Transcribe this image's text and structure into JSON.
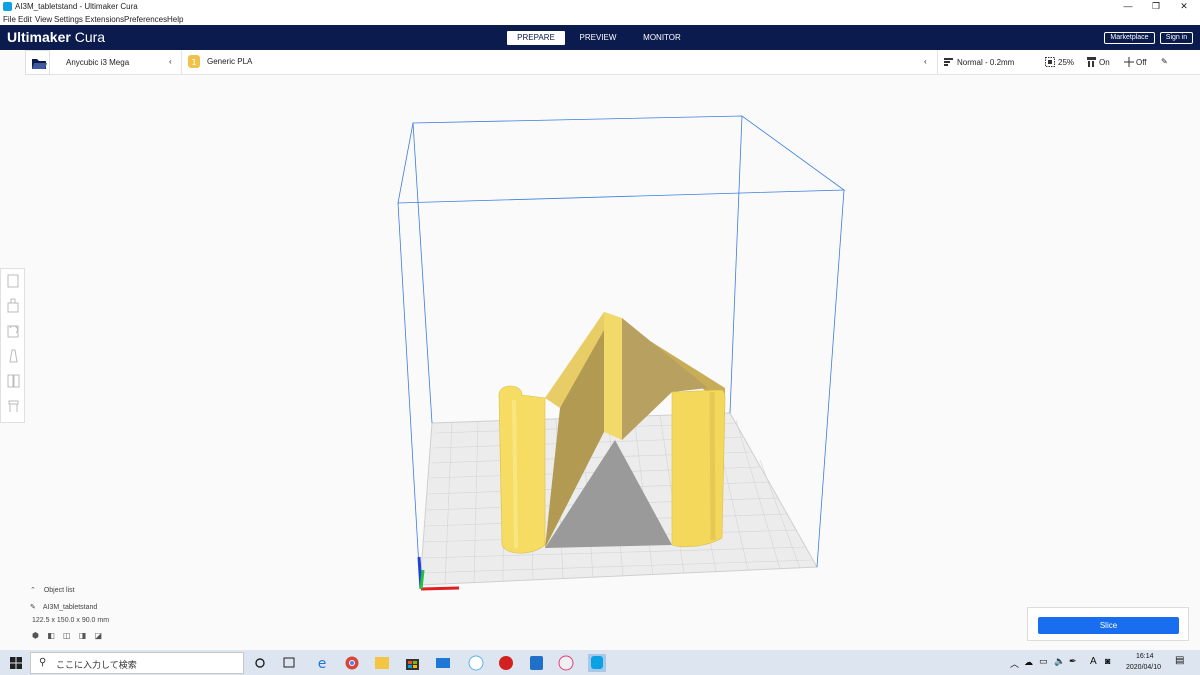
{
  "window": {
    "title": "AI3M_tabletstand - Ultimaker Cura",
    "controls": [
      "—",
      "❐",
      "✕"
    ]
  },
  "menu": [
    "File",
    "Edit",
    "View",
    "Settings",
    "Extensions",
    "Preferences",
    "Help"
  ],
  "header": {
    "logo_brand": "Ultimaker",
    "logo_product": "Cura",
    "tabs": [
      "PREPARE",
      "PREVIEW",
      "MONITOR"
    ],
    "active_tab": "PREPARE",
    "marketplace_label": "Marketplace",
    "signin_label": "Sign in"
  },
  "toolbar": {
    "printer": "Anycubic i3 Mega",
    "material": "Generic PLA",
    "profile": "Normal - 0.2mm",
    "infill": "25%",
    "support": "On",
    "adhesion": "Off"
  },
  "object_list": {
    "heading": "Object list",
    "object_name": "AI3M_tabletstand",
    "dimensions": "122.5 x 150.0 x 90.0 mm"
  },
  "slice": {
    "button_label": "Slice"
  },
  "taskbar": {
    "search_placeholder": "ここに入力して検索",
    "time": "16:14",
    "date": "2020/04/10",
    "ime": "A"
  },
  "colors": {
    "header_bg": "#0b1b4e",
    "accent": "#196ef0",
    "model": "#f5d866",
    "build_volume": "#3a7de0"
  }
}
